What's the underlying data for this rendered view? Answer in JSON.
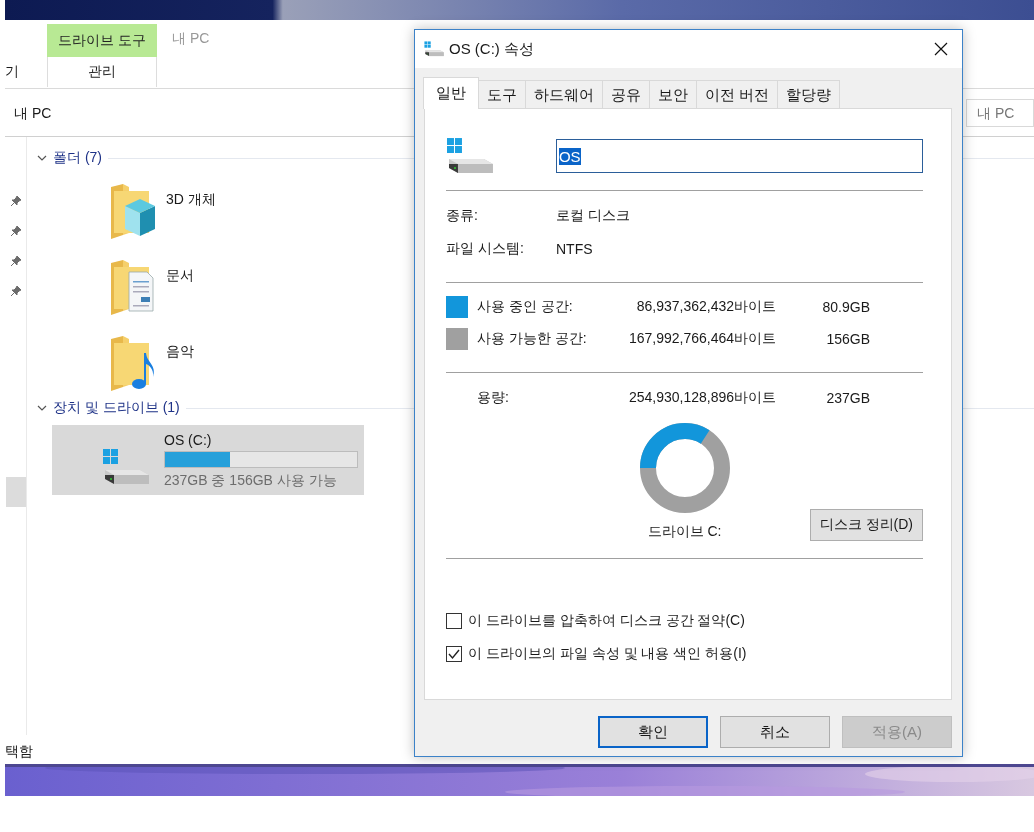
{
  "explorer": {
    "context_tab": {
      "label": "드라이브 도구",
      "sub_label": "관리",
      "selected": true
    },
    "window_title": "내 PC",
    "cut_tab": "기",
    "address": "내 PC",
    "search_placeholder": "내 PC",
    "groups": [
      {
        "title": "폴더 (7)",
        "expanded": true,
        "items": [
          {
            "kind": "objects",
            "label": "3D 개체",
            "selected": false
          },
          {
            "kind": "documents",
            "label": "문서",
            "selected": false
          },
          {
            "kind": "music",
            "label": "음악",
            "selected": false
          }
        ]
      },
      {
        "title": "장치 및 드라이브 (1)",
        "expanded": true,
        "items": [
          {
            "kind": "drive",
            "label": "OS (C:)",
            "level": 0.34,
            "detail": "237GB 중 156GB 사용 가능",
            "selected": true
          }
        ]
      }
    ],
    "status": "택함"
  },
  "dialog": {
    "title": "OS (C:) 속성",
    "tabs": [
      {
        "label": "일반",
        "selected": true
      },
      {
        "label": "도구",
        "selected": false
      },
      {
        "label": "하드웨어",
        "selected": false
      },
      {
        "label": "공유",
        "selected": false
      },
      {
        "label": "보안",
        "selected": false
      },
      {
        "label": "이전 버전",
        "selected": false
      },
      {
        "label": "할당량",
        "selected": false
      }
    ],
    "name": "OS",
    "info": [
      {
        "label": "종류:",
        "value": "로컬 디스크"
      },
      {
        "label": "파일 시스템:",
        "value": "NTFS"
      }
    ],
    "space": [
      {
        "label": "사용 중인 공간:",
        "bytes": "86,937,362,432바이트",
        "size": "80.9GB",
        "color": "#1296db"
      },
      {
        "label": "사용 가능한 공간:",
        "bytes": "167,992,766,464바이트",
        "size": "156GB",
        "color": "#a0a0a0"
      }
    ],
    "capacity": {
      "label": "용량:",
      "bytes": "254,930,128,896바이트",
      "size": "237GB"
    },
    "usage_ring": {
      "level": 0.341
    },
    "drive_label": "드라이브 C:",
    "cleanup_button": "디스크 정리(D)",
    "options": [
      {
        "label": "이 드라이브를 압축하여 디스크 공간 절약(C)",
        "checked": false
      },
      {
        "label": "이 드라이브의 파일 속성 및 내용 색인 허용(I)",
        "checked": true
      }
    ],
    "buttons": [
      {
        "label": "확인",
        "kind": "default",
        "disabled": false
      },
      {
        "label": "취소",
        "kind": "normal",
        "disabled": false
      },
      {
        "label": "적용(A)",
        "kind": "normal",
        "disabled": true
      }
    ]
  }
}
